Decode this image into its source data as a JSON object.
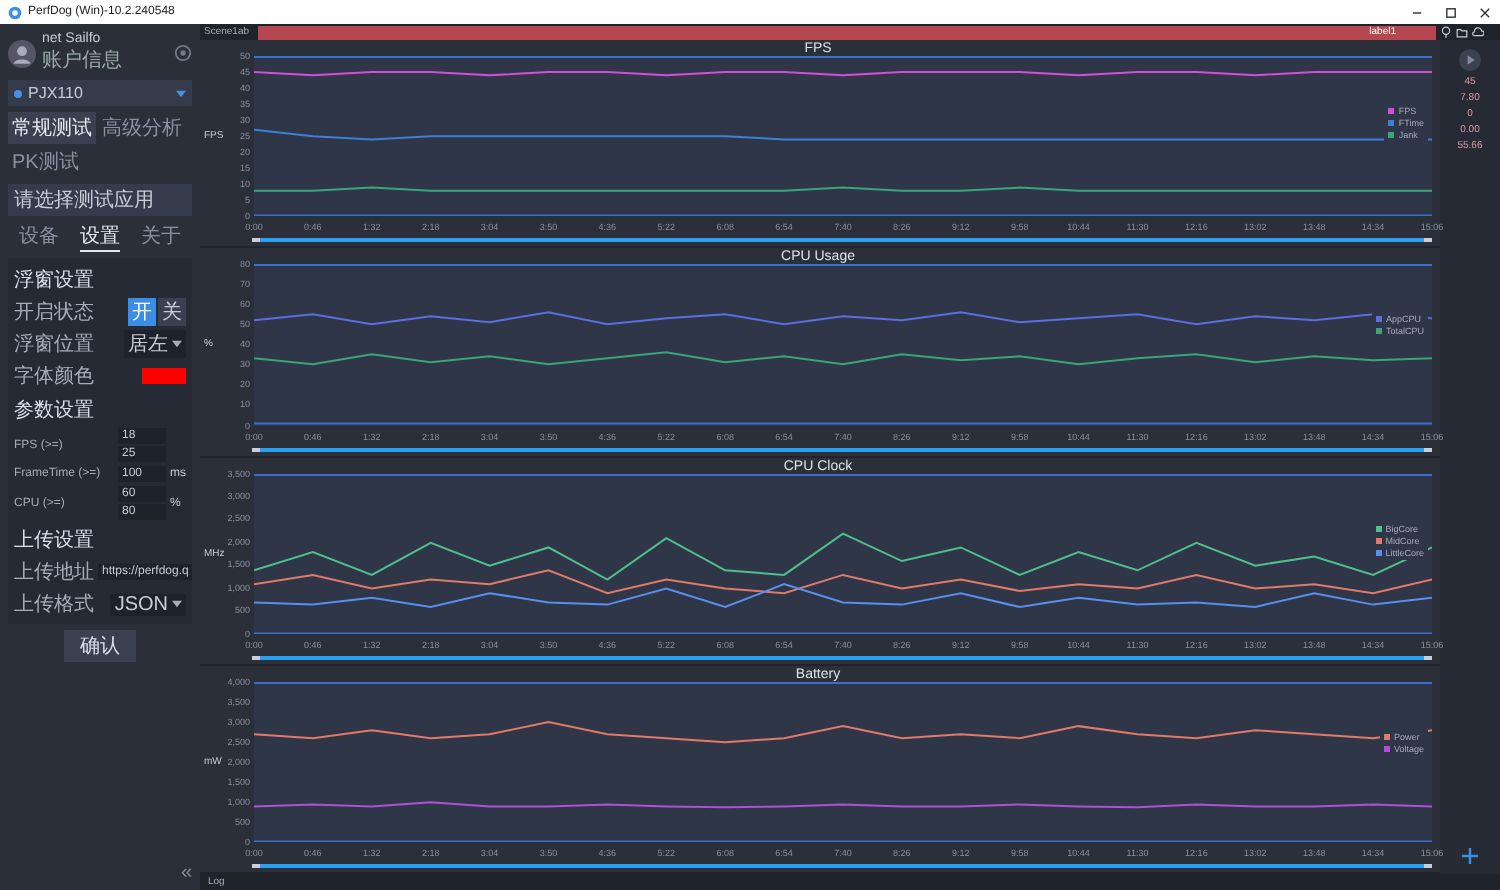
{
  "window": {
    "title": "PerfDog (Win)-10.2.240548"
  },
  "sidebar": {
    "user": {
      "name": "net Sailfo",
      "sub": "账户信息"
    },
    "device": "PJX110",
    "mode_tabs": [
      {
        "label": "常规测试",
        "selected": true
      },
      {
        "label": "高级分析",
        "selected": false
      },
      {
        "label": "PK测试",
        "selected": false
      }
    ],
    "app_select": {
      "placeholder": "请选择测试应用"
    },
    "panel_tabs": [
      {
        "label": "设备",
        "selected": false
      },
      {
        "label": "设置",
        "selected": true
      },
      {
        "label": "关于",
        "selected": false
      }
    ],
    "sections": [
      {
        "title": "浮窗设置",
        "rows": [
          {
            "kind": "toggle",
            "label": "开启状态",
            "options": [
              {
                "label": "开",
                "selected": true
              },
              {
                "label": "关",
                "selected": false
              }
            ]
          },
          {
            "kind": "select",
            "label": "浮窗位置",
            "value": "居左"
          },
          {
            "kind": "swatch",
            "label": "字体颜色",
            "color": "#ff0000"
          }
        ]
      },
      {
        "title": "参数设置",
        "rows": [
          {
            "kind": "inputs",
            "label": "FPS (>=)",
            "values": [
              "18",
              "25"
            ]
          },
          {
            "kind": "inputs",
            "label": "FrameTime (>=)",
            "values": [
              "100"
            ],
            "unit": "ms"
          },
          {
            "kind": "inputs",
            "label": "CPU (>=)",
            "values": [
              "60",
              "80"
            ],
            "unit": "%"
          }
        ]
      },
      {
        "title": "上传设置",
        "rows": [
          {
            "kind": "input",
            "label": "上传地址",
            "value": "https://perfdog.q"
          },
          {
            "kind": "select",
            "label": "上传格式",
            "value": "JSON"
          }
        ]
      }
    ],
    "confirm": "确认",
    "collapse": "«"
  },
  "scene_tab": "Scene1ab",
  "label_bar": "label1",
  "rail_values": [
    "45",
    "7.80",
    "0",
    "0.00",
    "55.66"
  ],
  "charts": [
    {
      "time_range": {
        "level": 1
      },
      "chart_data": {
        "type": "line",
        "title": "FPS",
        "ylabel": "FPS",
        "legend": true,
        "categories": [
          "0:00",
          "0:46",
          "1:32",
          "2:18",
          "3:04",
          "3:50",
          "4:36",
          "5:22",
          "6:08",
          "6:54",
          "7:40",
          "8:26",
          "9:12",
          "9:58",
          "10:44",
          "11:30",
          "12:16",
          "13:02",
          "13:48",
          "14:34",
          "15:06"
        ],
        "ylim": [
          0,
          50
        ],
        "yticks": [
          0,
          5,
          10,
          15,
          20,
          25,
          30,
          35,
          40,
          45,
          50
        ],
        "series": [
          {
            "name": "FPS",
            "color": "#d24fd8",
            "values": [
              45,
              44,
              45,
              45,
              44,
              45,
              45,
              44,
              45,
              45,
              44,
              45,
              45,
              45,
              44,
              45,
              45,
              44,
              45,
              45,
              45
            ]
          },
          {
            "name": "FTime",
            "color": "#3f7fd6",
            "values": [
              27,
              25,
              24,
              25,
              25,
              25,
              25,
              25,
              25,
              24,
              24,
              24,
              24,
              24,
              24,
              24,
              24,
              24,
              24,
              24,
              24
            ]
          },
          {
            "name": "Jank",
            "color": "#3aa57a",
            "values": [
              8,
              8,
              9,
              8,
              8,
              8,
              8,
              8,
              8,
              8,
              9,
              8,
              8,
              9,
              8,
              8,
              8,
              8,
              8,
              8,
              8
            ]
          }
        ]
      }
    },
    {
      "time_range": {
        "level": 1
      },
      "chart_data": {
        "type": "line",
        "title": "CPU Usage",
        "ylabel": "%",
        "legend": true,
        "categories": [
          "0:00",
          "0:46",
          "1:32",
          "2:18",
          "3:04",
          "3:50",
          "4:36",
          "5:22",
          "6:08",
          "6:54",
          "7:40",
          "8:26",
          "9:12",
          "9:58",
          "10:44",
          "11:30",
          "12:16",
          "13:02",
          "13:48",
          "14:34",
          "15:06"
        ],
        "ylim": [
          0,
          80
        ],
        "yticks": [
          0,
          10,
          20,
          30,
          40,
          50,
          60,
          70,
          80
        ],
        "series": [
          {
            "name": "AppCPU",
            "color": "#5a6fe0",
            "values": [
              52,
              55,
              50,
              54,
              51,
              56,
              50,
              53,
              55,
              50,
              54,
              52,
              56,
              51,
              53,
              55,
              50,
              54,
              52,
              55,
              53
            ]
          },
          {
            "name": "TotalCPU",
            "color": "#3aa57a",
            "values": [
              33,
              30,
              35,
              31,
              34,
              30,
              33,
              36,
              31,
              34,
              30,
              35,
              32,
              34,
              30,
              33,
              35,
              31,
              34,
              32,
              33
            ]
          }
        ]
      }
    },
    {
      "time_range": {
        "level": 1
      },
      "chart_data": {
        "type": "line",
        "title": "CPU Clock",
        "ylabel": "MHz",
        "legend": true,
        "categories": [
          "0:00",
          "0:46",
          "1:32",
          "2:18",
          "3:04",
          "3:50",
          "4:36",
          "5:22",
          "6:08",
          "6:54",
          "7:40",
          "8:26",
          "9:12",
          "9:58",
          "10:44",
          "11:30",
          "12:16",
          "13:02",
          "13:48",
          "14:34",
          "15:06"
        ],
        "ylim": [
          0,
          3500
        ],
        "yticks": [
          0,
          500,
          {
            "value": 1000,
            "label": "1,000"
          },
          {
            "value": 1500,
            "label": "1,500"
          },
          {
            "value": 2000,
            "label": "2,000"
          },
          {
            "value": 2500,
            "label": "2,500"
          },
          {
            "value": 3000,
            "label": "3,000"
          },
          {
            "value": 3500,
            "label": "3,500"
          }
        ],
        "series": [
          {
            "name": "BigCore",
            "color": "#4fc08d",
            "values": [
              1400,
              1800,
              1300,
              2000,
              1500,
              1900,
              1200,
              2100,
              1400,
              1300,
              2200,
              1600,
              1900,
              1300,
              1800,
              1400,
              2000,
              1500,
              1700,
              1300,
              1900
            ]
          },
          {
            "name": "MidCore",
            "color": "#e07a6a",
            "values": [
              1100,
              1300,
              1000,
              1200,
              1100,
              1400,
              900,
              1200,
              1000,
              900,
              1300,
              1000,
              1200,
              950,
              1100,
              1000,
              1300,
              1000,
              1100,
              900,
              1200
            ]
          },
          {
            "name": "LittleCore",
            "color": "#5a8ff0",
            "values": [
              700,
              650,
              800,
              600,
              900,
              700,
              650,
              1000,
              600,
              1100,
              700,
              650,
              900,
              600,
              800,
              650,
              700,
              600,
              900,
              650,
              800
            ]
          }
        ]
      }
    },
    {
      "time_range": {
        "level": 1
      },
      "chart_data": {
        "type": "line",
        "title": "Battery",
        "ylabel": "mW",
        "legend": true,
        "categories": [
          "0:00",
          "0:46",
          "1:32",
          "2:18",
          "3:04",
          "3:50",
          "4:36",
          "5:22",
          "6:08",
          "6:54",
          "7:40",
          "8:26",
          "9:12",
          "9:58",
          "10:44",
          "11:30",
          "12:16",
          "13:02",
          "13:48",
          "14:34",
          "15:06"
        ],
        "ylim": [
          0,
          4000
        ],
        "yticks": [
          0,
          500,
          {
            "value": 1000,
            "label": "1,000"
          },
          {
            "value": 1500,
            "label": "1,500"
          },
          {
            "value": 2000,
            "label": "2,000"
          },
          {
            "value": 2500,
            "label": "2,500"
          },
          {
            "value": 3000,
            "label": "3,000"
          },
          {
            "value": 3500,
            "label": "3,500"
          },
          {
            "value": 4000,
            "label": "4,000"
          }
        ],
        "series": [
          {
            "name": "Power",
            "color": "#e07a6a",
            "values": [
              2700,
              2600,
              2800,
              2600,
              2700,
              3000,
              2700,
              2600,
              2500,
              2600,
              2900,
              2600,
              2700,
              2600,
              2900,
              2700,
              2600,
              2800,
              2700,
              2600,
              2800
            ]
          },
          {
            "name": "Voltage",
            "color": "#b04fd8",
            "values": [
              900,
              950,
              900,
              1000,
              900,
              900,
              950,
              900,
              880,
              900,
              950,
              900,
              900,
              950,
              900,
              880,
              950,
              900,
              900,
              950,
              900
            ]
          }
        ]
      }
    }
  ],
  "log": "Log"
}
